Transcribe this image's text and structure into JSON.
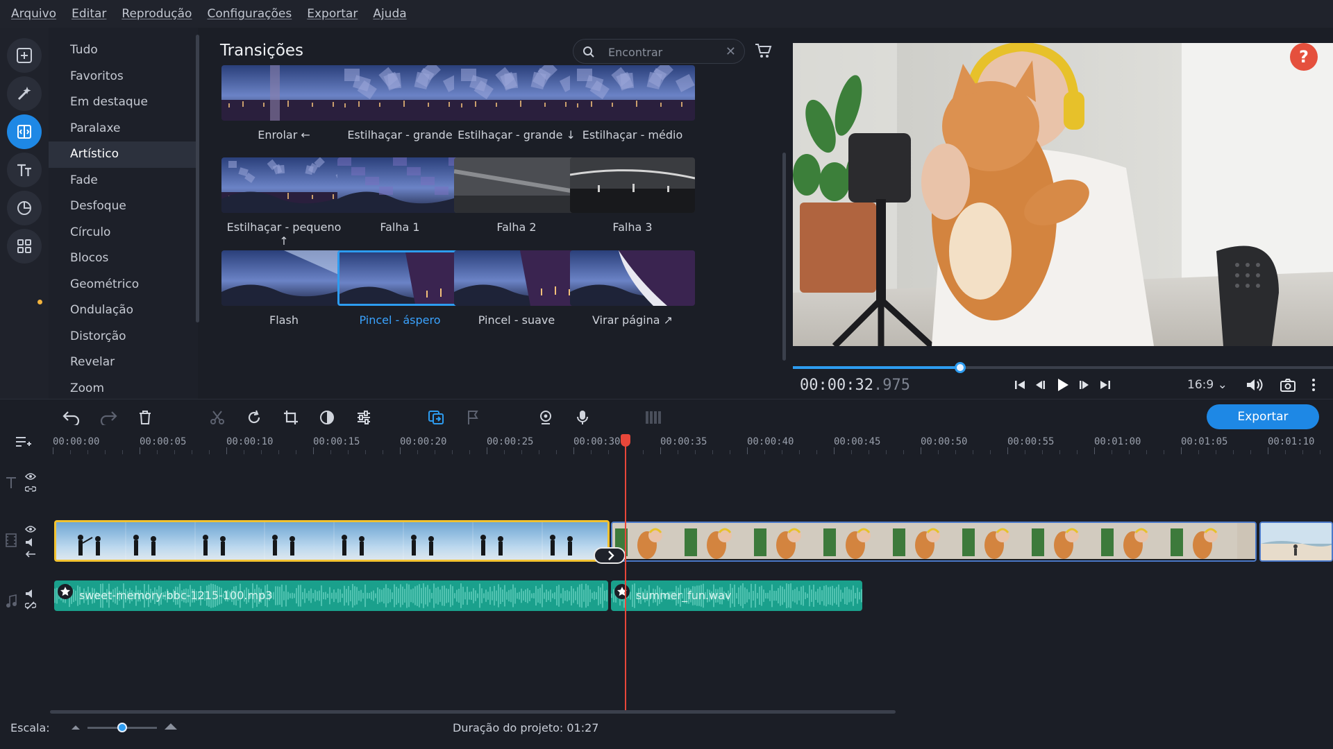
{
  "menu": [
    "Arquivo",
    "Editar",
    "Reprodução",
    "Configurações",
    "Exportar",
    "Ajuda"
  ],
  "rail": [
    {
      "icon": "import-icon",
      "active": false
    },
    {
      "icon": "magic-wand-icon",
      "active": false
    },
    {
      "icon": "transitions-icon",
      "active": true
    },
    {
      "icon": "titles-icon",
      "active": false
    },
    {
      "icon": "stickers-icon",
      "active": false
    },
    {
      "icon": "more-tools-icon",
      "active": false
    }
  ],
  "categories": {
    "items": [
      "Tudo",
      "Favoritos",
      "Em destaque",
      "Paralaxe",
      "Artístico",
      "Fade",
      "Desfoque",
      "Círculo",
      "Blocos",
      "Geométrico",
      "Ondulação",
      "Distorção",
      "Revelar",
      "Zoom"
    ],
    "active_index": 4
  },
  "panel": {
    "title": "Transições",
    "search_placeholder": "Encontrar",
    "search_value": ""
  },
  "tiles": [
    {
      "label": "Enrolar ←",
      "scene": "roll"
    },
    {
      "label": "Estilhaçar - grande",
      "scene": "shatter"
    },
    {
      "label": "Estilhaçar - grande ↓",
      "scene": "shatter"
    },
    {
      "label": "Estilhaçar - médio",
      "scene": "shatter"
    },
    {
      "label": "Estilhaçar - pequeno ↑",
      "scene": "shatter-small"
    },
    {
      "label": "Falha 1",
      "scene": "glitch-blue"
    },
    {
      "label": "Falha 2",
      "scene": "glitch-gray"
    },
    {
      "label": "Falha 3",
      "scene": "glitch-dark"
    },
    {
      "label": "Flash",
      "scene": "flash"
    },
    {
      "label": "Pincel - áspero",
      "scene": "brush",
      "selected": true
    },
    {
      "label": "Pincel - suave",
      "scene": "brush"
    },
    {
      "label": "Virar página ↗",
      "scene": "page"
    }
  ],
  "preview": {
    "timecode_main": "00:00:32",
    "timecode_ms": ".975",
    "progress": 0.31,
    "aspect_ratio": "16:9 ⌄",
    "help": "?"
  },
  "toolbar": {
    "export_label": "Exportar"
  },
  "ruler": {
    "labels": [
      "00:00:00",
      "00:00:05",
      "00:00:10",
      "00:00:15",
      "00:00:20",
      "00:00:25",
      "00:00:30",
      "00:00:35",
      "00:00:40",
      "00:00:45",
      "00:00:50",
      "00:00:55",
      "00:01:00",
      "00:01:05",
      "00:01:10"
    ],
    "playhead_seconds": 32.975
  },
  "audio_clips": [
    {
      "name": "sweet-memory-bbc-1215-100.mp3"
    },
    {
      "name": "summer_fun.wav"
    }
  ],
  "status": {
    "scale_label": "Escala:",
    "scale_value": 0.5,
    "duration_label": "Duração do projeto: 01:27"
  },
  "colors": {
    "accent": "#1e88e5",
    "selected_clip_border": "#f2c230",
    "audio": "#1aa08c",
    "playhead": "#e8473a",
    "help": "#e5503d"
  }
}
